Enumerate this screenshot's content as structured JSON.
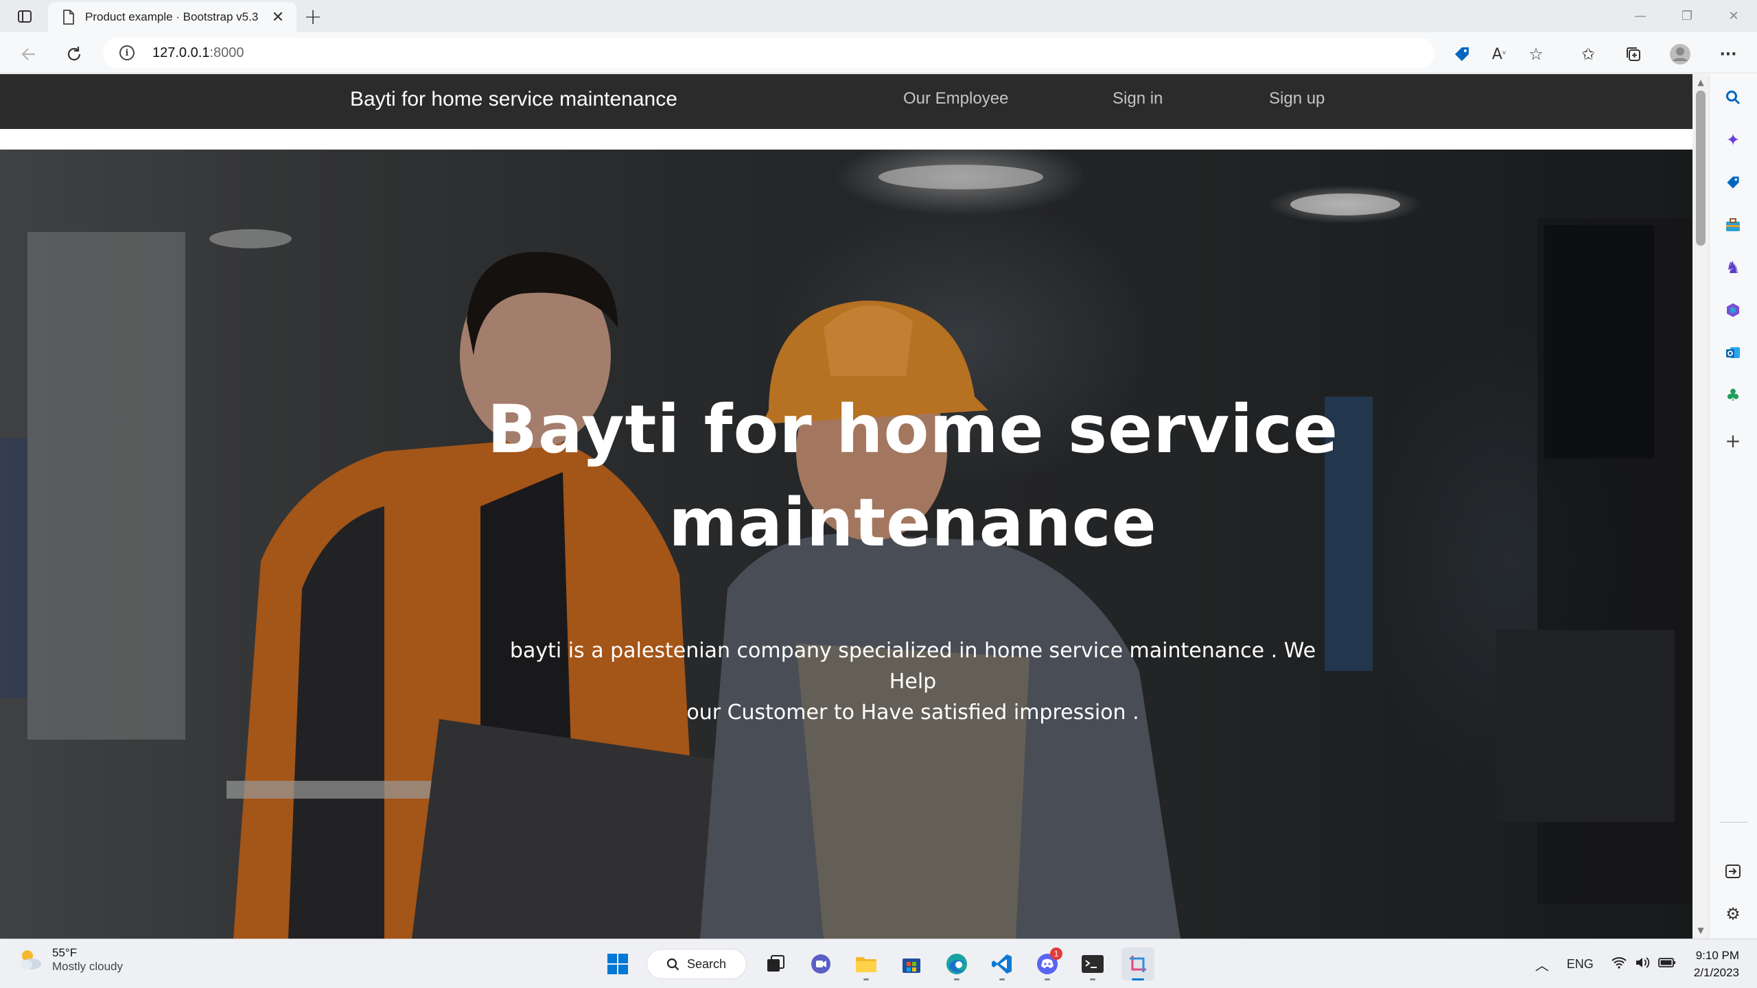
{
  "browser": {
    "tab_title": "Product example · Bootstrap v5.3",
    "tab_close": "✕",
    "new_tab": "+",
    "url_host": "127.0.0.1",
    "url_port": ":8000"
  },
  "site": {
    "brand": "Bayti for home service maintenance",
    "nav_links": [
      "Our Employee",
      "Sign in",
      "Sign up"
    ]
  },
  "hero": {
    "title_line1": "Bayti for home service",
    "title_line2": "maintenance",
    "text_line1": "bayti is a palestenian company specialized in home service maintenance . We Help",
    "text_line2": "our Customer to Have satisfied impression ."
  },
  "taskbar": {
    "weather_temp": "55°F",
    "weather_desc": "Mostly cloudy",
    "search_label": "Search",
    "language": "ENG",
    "time": "9:10 PM",
    "date": "2/1/2023",
    "discord_badge": "1"
  },
  "colors": {
    "site_nav_bg": "#2b2b2b",
    "edge_accent": "#0067c0",
    "windows_accent": "#0078d4"
  }
}
